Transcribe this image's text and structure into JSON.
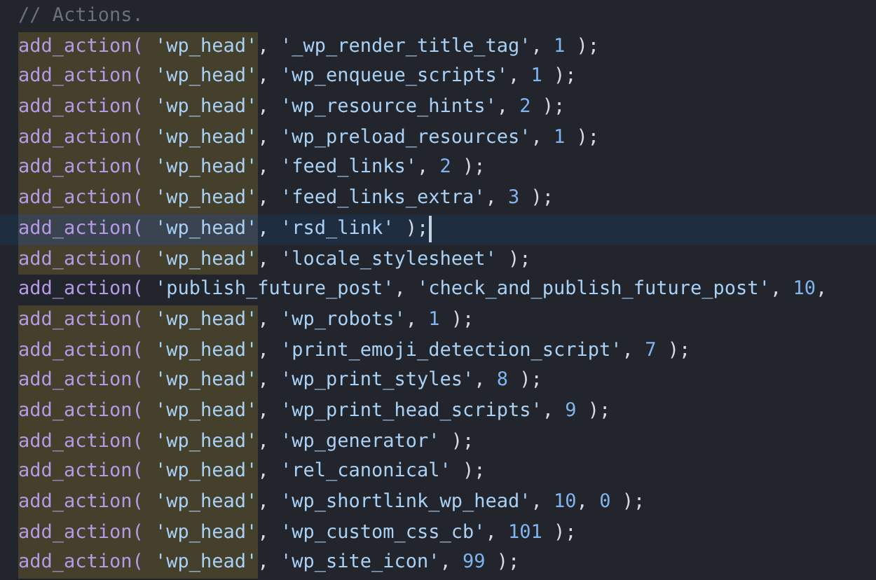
{
  "lines": [
    {
      "match": false,
      "current": false,
      "segments": [
        {
          "kind": "comment",
          "text": "// Actions."
        }
      ]
    },
    {
      "match": true,
      "current": false,
      "segments": [
        {
          "kind": "fn",
          "text": "add_action("
        },
        {
          "kind": "str",
          "text": " 'wp_head'"
        },
        {
          "kind": "punct",
          "text": ", "
        },
        {
          "kind": "str",
          "text": "'_wp_render_title_tag'"
        },
        {
          "kind": "punct",
          "text": ", "
        },
        {
          "kind": "num",
          "text": "1"
        },
        {
          "kind": "punct",
          "text": " );"
        }
      ]
    },
    {
      "match": true,
      "current": false,
      "segments": [
        {
          "kind": "fn",
          "text": "add_action("
        },
        {
          "kind": "str",
          "text": " 'wp_head'"
        },
        {
          "kind": "punct",
          "text": ", "
        },
        {
          "kind": "str",
          "text": "'wp_enqueue_scripts'"
        },
        {
          "kind": "punct",
          "text": ", "
        },
        {
          "kind": "num",
          "text": "1"
        },
        {
          "kind": "punct",
          "text": " );"
        }
      ]
    },
    {
      "match": true,
      "current": false,
      "segments": [
        {
          "kind": "fn",
          "text": "add_action("
        },
        {
          "kind": "str",
          "text": " 'wp_head'"
        },
        {
          "kind": "punct",
          "text": ", "
        },
        {
          "kind": "str",
          "text": "'wp_resource_hints'"
        },
        {
          "kind": "punct",
          "text": ", "
        },
        {
          "kind": "num",
          "text": "2"
        },
        {
          "kind": "punct",
          "text": " );"
        }
      ]
    },
    {
      "match": true,
      "current": false,
      "segments": [
        {
          "kind": "fn",
          "text": "add_action("
        },
        {
          "kind": "str",
          "text": " 'wp_head'"
        },
        {
          "kind": "punct",
          "text": ", "
        },
        {
          "kind": "str",
          "text": "'wp_preload_resources'"
        },
        {
          "kind": "punct",
          "text": ", "
        },
        {
          "kind": "num",
          "text": "1"
        },
        {
          "kind": "punct",
          "text": " );"
        }
      ]
    },
    {
      "match": true,
      "current": false,
      "segments": [
        {
          "kind": "fn",
          "text": "add_action("
        },
        {
          "kind": "str",
          "text": " 'wp_head'"
        },
        {
          "kind": "punct",
          "text": ", "
        },
        {
          "kind": "str",
          "text": "'feed_links'"
        },
        {
          "kind": "punct",
          "text": ", "
        },
        {
          "kind": "num",
          "text": "2"
        },
        {
          "kind": "punct",
          "text": " );"
        }
      ]
    },
    {
      "match": true,
      "current": false,
      "segments": [
        {
          "kind": "fn",
          "text": "add_action("
        },
        {
          "kind": "str",
          "text": " 'wp_head'"
        },
        {
          "kind": "punct",
          "text": ", "
        },
        {
          "kind": "str",
          "text": "'feed_links_extra'"
        },
        {
          "kind": "punct",
          "text": ", "
        },
        {
          "kind": "num",
          "text": "3"
        },
        {
          "kind": "punct",
          "text": " );"
        }
      ]
    },
    {
      "match": true,
      "current": true,
      "segments": [
        {
          "kind": "fn",
          "text": "add_action("
        },
        {
          "kind": "str",
          "text": " 'wp_head'"
        },
        {
          "kind": "punct",
          "text": ", "
        },
        {
          "kind": "str",
          "text": "'rsd_link'"
        },
        {
          "kind": "punct",
          "text": " );"
        }
      ]
    },
    {
      "match": true,
      "current": false,
      "segments": [
        {
          "kind": "fn",
          "text": "add_action("
        },
        {
          "kind": "str",
          "text": " 'wp_head'"
        },
        {
          "kind": "punct",
          "text": ", "
        },
        {
          "kind": "str",
          "text": "'locale_stylesheet'"
        },
        {
          "kind": "punct",
          "text": " );"
        }
      ]
    },
    {
      "match": false,
      "current": false,
      "segments": [
        {
          "kind": "fn",
          "text": "add_action("
        },
        {
          "kind": "str",
          "text": " 'publish_future_post'"
        },
        {
          "kind": "punct",
          "text": ", "
        },
        {
          "kind": "str",
          "text": "'check_and_publish_future_post'"
        },
        {
          "kind": "punct",
          "text": ", "
        },
        {
          "kind": "num",
          "text": "10"
        },
        {
          "kind": "punct",
          "text": ","
        }
      ]
    },
    {
      "match": true,
      "current": false,
      "segments": [
        {
          "kind": "fn",
          "text": "add_action("
        },
        {
          "kind": "str",
          "text": " 'wp_head'"
        },
        {
          "kind": "punct",
          "text": ", "
        },
        {
          "kind": "str",
          "text": "'wp_robots'"
        },
        {
          "kind": "punct",
          "text": ", "
        },
        {
          "kind": "num",
          "text": "1"
        },
        {
          "kind": "punct",
          "text": " );"
        }
      ]
    },
    {
      "match": true,
      "current": false,
      "segments": [
        {
          "kind": "fn",
          "text": "add_action("
        },
        {
          "kind": "str",
          "text": " 'wp_head'"
        },
        {
          "kind": "punct",
          "text": ", "
        },
        {
          "kind": "str",
          "text": "'print_emoji_detection_script'"
        },
        {
          "kind": "punct",
          "text": ", "
        },
        {
          "kind": "num",
          "text": "7"
        },
        {
          "kind": "punct",
          "text": " );"
        }
      ]
    },
    {
      "match": true,
      "current": false,
      "segments": [
        {
          "kind": "fn",
          "text": "add_action("
        },
        {
          "kind": "str",
          "text": " 'wp_head'"
        },
        {
          "kind": "punct",
          "text": ", "
        },
        {
          "kind": "str",
          "text": "'wp_print_styles'"
        },
        {
          "kind": "punct",
          "text": ", "
        },
        {
          "kind": "num",
          "text": "8"
        },
        {
          "kind": "punct",
          "text": " );"
        }
      ]
    },
    {
      "match": true,
      "current": false,
      "segments": [
        {
          "kind": "fn",
          "text": "add_action("
        },
        {
          "kind": "str",
          "text": " 'wp_head'"
        },
        {
          "kind": "punct",
          "text": ", "
        },
        {
          "kind": "str",
          "text": "'wp_print_head_scripts'"
        },
        {
          "kind": "punct",
          "text": ", "
        },
        {
          "kind": "num",
          "text": "9"
        },
        {
          "kind": "punct",
          "text": " );"
        }
      ]
    },
    {
      "match": true,
      "current": false,
      "segments": [
        {
          "kind": "fn",
          "text": "add_action("
        },
        {
          "kind": "str",
          "text": " 'wp_head'"
        },
        {
          "kind": "punct",
          "text": ", "
        },
        {
          "kind": "str",
          "text": "'wp_generator'"
        },
        {
          "kind": "punct",
          "text": " );"
        }
      ]
    },
    {
      "match": true,
      "current": false,
      "segments": [
        {
          "kind": "fn",
          "text": "add_action("
        },
        {
          "kind": "str",
          "text": " 'wp_head'"
        },
        {
          "kind": "punct",
          "text": ", "
        },
        {
          "kind": "str",
          "text": "'rel_canonical'"
        },
        {
          "kind": "punct",
          "text": " );"
        }
      ]
    },
    {
      "match": true,
      "current": false,
      "segments": [
        {
          "kind": "fn",
          "text": "add_action("
        },
        {
          "kind": "str",
          "text": " 'wp_head'"
        },
        {
          "kind": "punct",
          "text": ", "
        },
        {
          "kind": "str",
          "text": "'wp_shortlink_wp_head'"
        },
        {
          "kind": "punct",
          "text": ", "
        },
        {
          "kind": "num",
          "text": "10"
        },
        {
          "kind": "punct",
          "text": ", "
        },
        {
          "kind": "num",
          "text": "0"
        },
        {
          "kind": "punct",
          "text": " );"
        }
      ]
    },
    {
      "match": true,
      "current": false,
      "segments": [
        {
          "kind": "fn",
          "text": "add_action("
        },
        {
          "kind": "str",
          "text": " 'wp_head'"
        },
        {
          "kind": "punct",
          "text": ", "
        },
        {
          "kind": "str",
          "text": "'wp_custom_css_cb'"
        },
        {
          "kind": "punct",
          "text": ", "
        },
        {
          "kind": "num",
          "text": "101"
        },
        {
          "kind": "punct",
          "text": " );"
        }
      ]
    },
    {
      "match": true,
      "current": false,
      "segments": [
        {
          "kind": "fn",
          "text": "add_action("
        },
        {
          "kind": "str",
          "text": " 'wp_head'"
        },
        {
          "kind": "punct",
          "text": ", "
        },
        {
          "kind": "str",
          "text": "'wp_site_icon'"
        },
        {
          "kind": "punct",
          "text": ", "
        },
        {
          "kind": "num",
          "text": "99"
        },
        {
          "kind": "punct",
          "text": " );"
        }
      ]
    }
  ]
}
